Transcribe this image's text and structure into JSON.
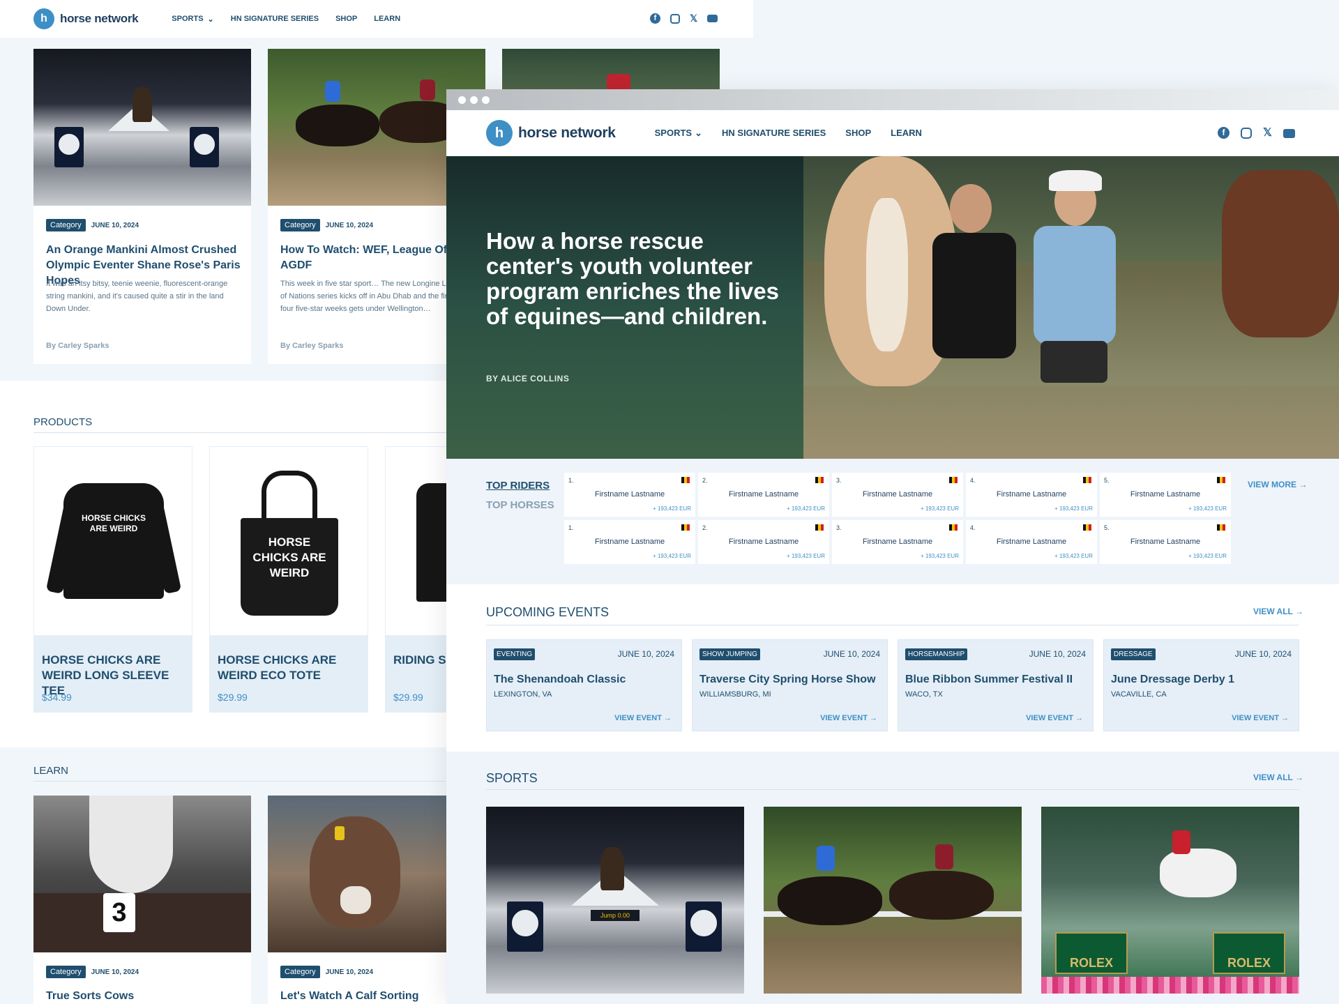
{
  "brand": {
    "name": "horse network"
  },
  "nav": {
    "items": [
      "SPORTS",
      "HN SIGNATURE SERIES",
      "SHOP",
      "LEARN"
    ]
  },
  "social": {
    "icons": [
      "facebook-icon",
      "instagram-icon",
      "x-icon",
      "youtube-icon"
    ]
  },
  "back": {
    "articles": [
      {
        "tag": "Category",
        "date": "JUNE 10, 2024",
        "title": "An Orange Mankini Almost Crushed Olympic Eventer Shane Rose's Paris Hopes",
        "excerpt": "It was an itsy bitsy, teenie weenie, fluorescent-orange string mankini, and it's caused quite a stir in the land Down Under.",
        "byline": "By Carley Sparks"
      },
      {
        "tag": "Category",
        "date": "JUNE 10, 2024",
        "title": "How To Watch: WEF, League Of Natio AGDF",
        "excerpt": "This week in five star sport… The new Longine League of Nations series kicks off in Abu Dhab and the first of four five-star weeks gets under Wellington…",
        "byline": "By Carley Sparks"
      }
    ],
    "products_heading": "PRODUCTS",
    "products": [
      {
        "name": "HORSE CHICKS ARE WEIRD LONG SLEEVE TEE",
        "price": "$34.99",
        "print": "HORSE CHICKS ARE WEIRD"
      },
      {
        "name": "HORSE CHICKS ARE WEIRD ECO TOTE",
        "price": "$29.99",
        "print": "HORSE CHICKS ARE WEIRD"
      },
      {
        "name": "RIDING SCH UNISEX TE",
        "price": "$29.99"
      }
    ],
    "learn_heading": "LEARN",
    "learn": [
      {
        "tag": "Category",
        "date": "JUNE 10, 2024",
        "title": "True Sorts Cows",
        "bib": "3"
      },
      {
        "tag": "Category",
        "date": "JUNE 10, 2024",
        "title": "Let's Watch A Calf Sorting"
      }
    ]
  },
  "hero": {
    "title": "How a horse rescue center's youth volunteer program enriches the lives of equines—and children.",
    "byline": "BY ALICE COLLINS"
  },
  "rankings": {
    "tabs": [
      "TOP RIDERS",
      "TOP HORSES"
    ],
    "view_more": "VIEW MORE",
    "rows": [
      [
        {
          "rank": "1.",
          "name": "Firstname Lastname",
          "points": "+ 193,423 EUR"
        },
        {
          "rank": "2.",
          "name": "Firstname Lastname",
          "points": "+ 193,423 EUR"
        },
        {
          "rank": "3.",
          "name": "Firstname Lastname",
          "points": "+ 193,423 EUR"
        },
        {
          "rank": "4.",
          "name": "Firstname Lastname",
          "points": "+ 193,423 EUR"
        },
        {
          "rank": "5.",
          "name": "Firstname Lastname",
          "points": "+ 193,423 EUR"
        }
      ],
      [
        {
          "rank": "1.",
          "name": "Firstname Lastname",
          "points": "+ 193,423 EUR"
        },
        {
          "rank": "2.",
          "name": "Firstname Lastname",
          "points": "+ 193,423 EUR"
        },
        {
          "rank": "3.",
          "name": "Firstname Lastname",
          "points": "+ 193,423 EUR"
        },
        {
          "rank": "4.",
          "name": "Firstname Lastname",
          "points": "+ 193,423 EUR"
        },
        {
          "rank": "5.",
          "name": "Firstname Lastname",
          "points": "+ 193,423 EUR"
        }
      ]
    ]
  },
  "events": {
    "heading": "UPCOMING EVENTS",
    "view_all": "VIEW ALL",
    "items": [
      {
        "tag": "EVENTING",
        "date": "JUNE 10, 2024",
        "name": "The Shenandoah Classic",
        "location": "LEXINGTON, VA",
        "cta": "VIEW EVENT"
      },
      {
        "tag": "SHOW JUMPING",
        "date": "JUNE 10, 2024",
        "name": "Traverse City Spring Horse Show",
        "location": "WILLIAMSBURG, MI",
        "cta": "VIEW EVENT"
      },
      {
        "tag": "HORSEMANSHIP",
        "date": "JUNE 10, 2024",
        "name": "Blue Ribbon Summer Festival II",
        "location": "WACO, TX",
        "cta": "VIEW EVENT"
      },
      {
        "tag": "DRESSAGE",
        "date": "JUNE 10, 2024",
        "name": "June Dressage Derby 1",
        "location": "VACAVILLE, CA",
        "cta": "VIEW EVENT"
      }
    ]
  },
  "sports": {
    "heading": "SPORTS",
    "view_all": "VIEW ALL",
    "image_text": {
      "clock": "Jump 0.00",
      "ad": "ROLEX"
    }
  },
  "colors": {
    "brand": "#1f4e6e",
    "accent": "#3f8fc7"
  }
}
